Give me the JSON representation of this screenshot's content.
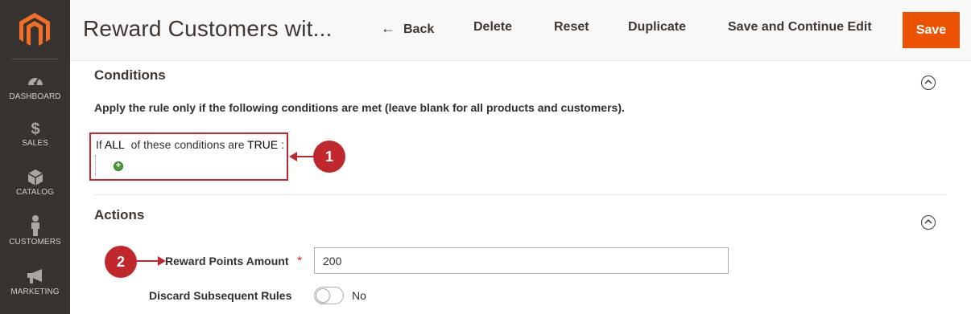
{
  "sidebar": {
    "items": [
      {
        "label": "DASHBOARD",
        "icon": "dashboard-icon"
      },
      {
        "label": "SALES",
        "icon": "dollar-icon"
      },
      {
        "label": "CATALOG",
        "icon": "box-icon"
      },
      {
        "label": "CUSTOMERS",
        "icon": "person-icon"
      },
      {
        "label": "MARKETING",
        "icon": "megaphone-icon"
      }
    ]
  },
  "header": {
    "title": "Reward Customers wit...",
    "back_label": "Back",
    "delete_label": "Delete",
    "reset_label": "Reset",
    "duplicate_label": "Duplicate",
    "save_continue_label": "Save and Continue Edit",
    "save_label": "Save"
  },
  "conditions": {
    "title": "Conditions",
    "description": "Apply the rule only if the following conditions are met (leave blank for all products and customers).",
    "prefix": "If",
    "aggregator": "ALL",
    "middle": "of these conditions are",
    "value": "TRUE",
    "suffix": ":"
  },
  "actions": {
    "title": "Actions",
    "reward_points_label": "Reward Points Amount",
    "reward_points_value": "200",
    "required_mark": "*",
    "discard_label": "Discard Subsequent Rules",
    "discard_value": "No"
  },
  "annotations": {
    "badge1": "1",
    "badge2": "2"
  },
  "colors": {
    "sidebar_bg": "#373330",
    "accent": "#eb5202",
    "annotation": "#c0282d"
  }
}
